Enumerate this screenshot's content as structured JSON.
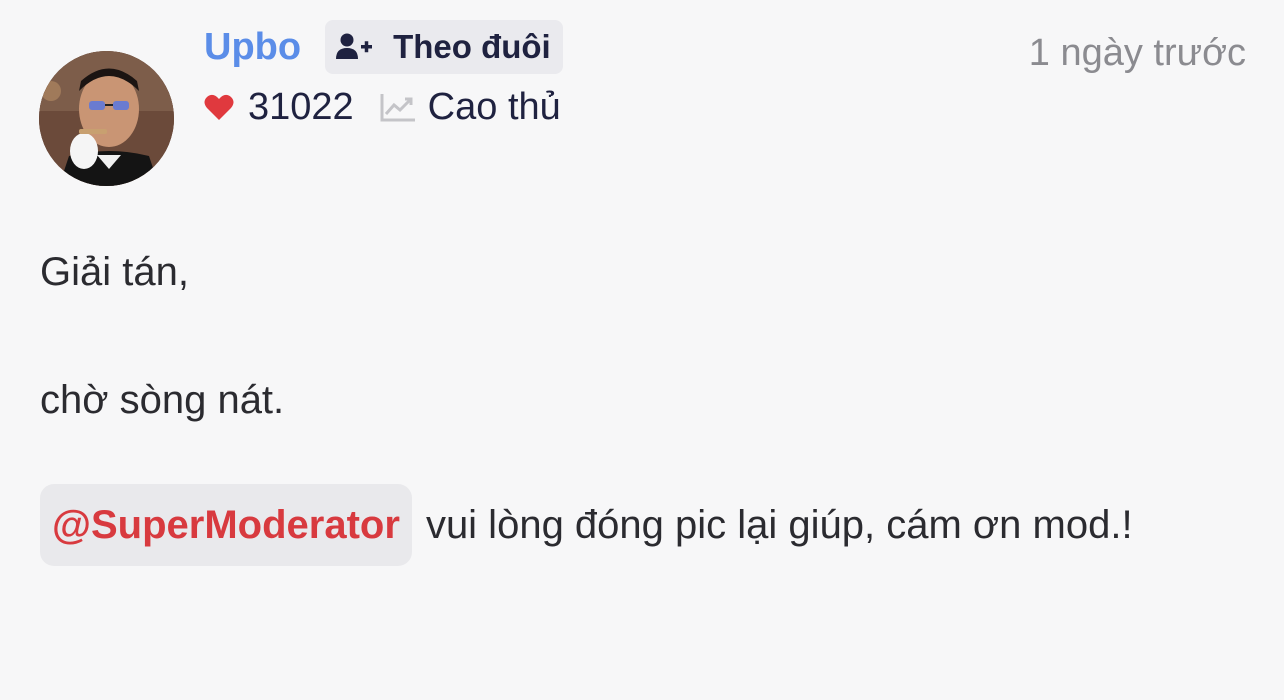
{
  "post": {
    "author": {
      "username": "Upbo",
      "likes": "31022",
      "rank": "Cao thủ"
    },
    "follow_label": "Theo đuôi",
    "timestamp": "1 ngày trước",
    "body": {
      "line1": "Giải tán,",
      "line2": "chờ sòng nát.",
      "mention": "@SuperModerator",
      "line3_rest": "vui lòng đóng pic lại giúp, cám ơn mod.!"
    }
  },
  "colors": {
    "username": "#5b8de8",
    "mention_text": "#d83a3f",
    "heart": "#e0393e",
    "background": "#f7f7f8"
  },
  "icons": [
    "avatar-photo",
    "user-plus-icon",
    "heart-icon",
    "chart-line-icon"
  ]
}
